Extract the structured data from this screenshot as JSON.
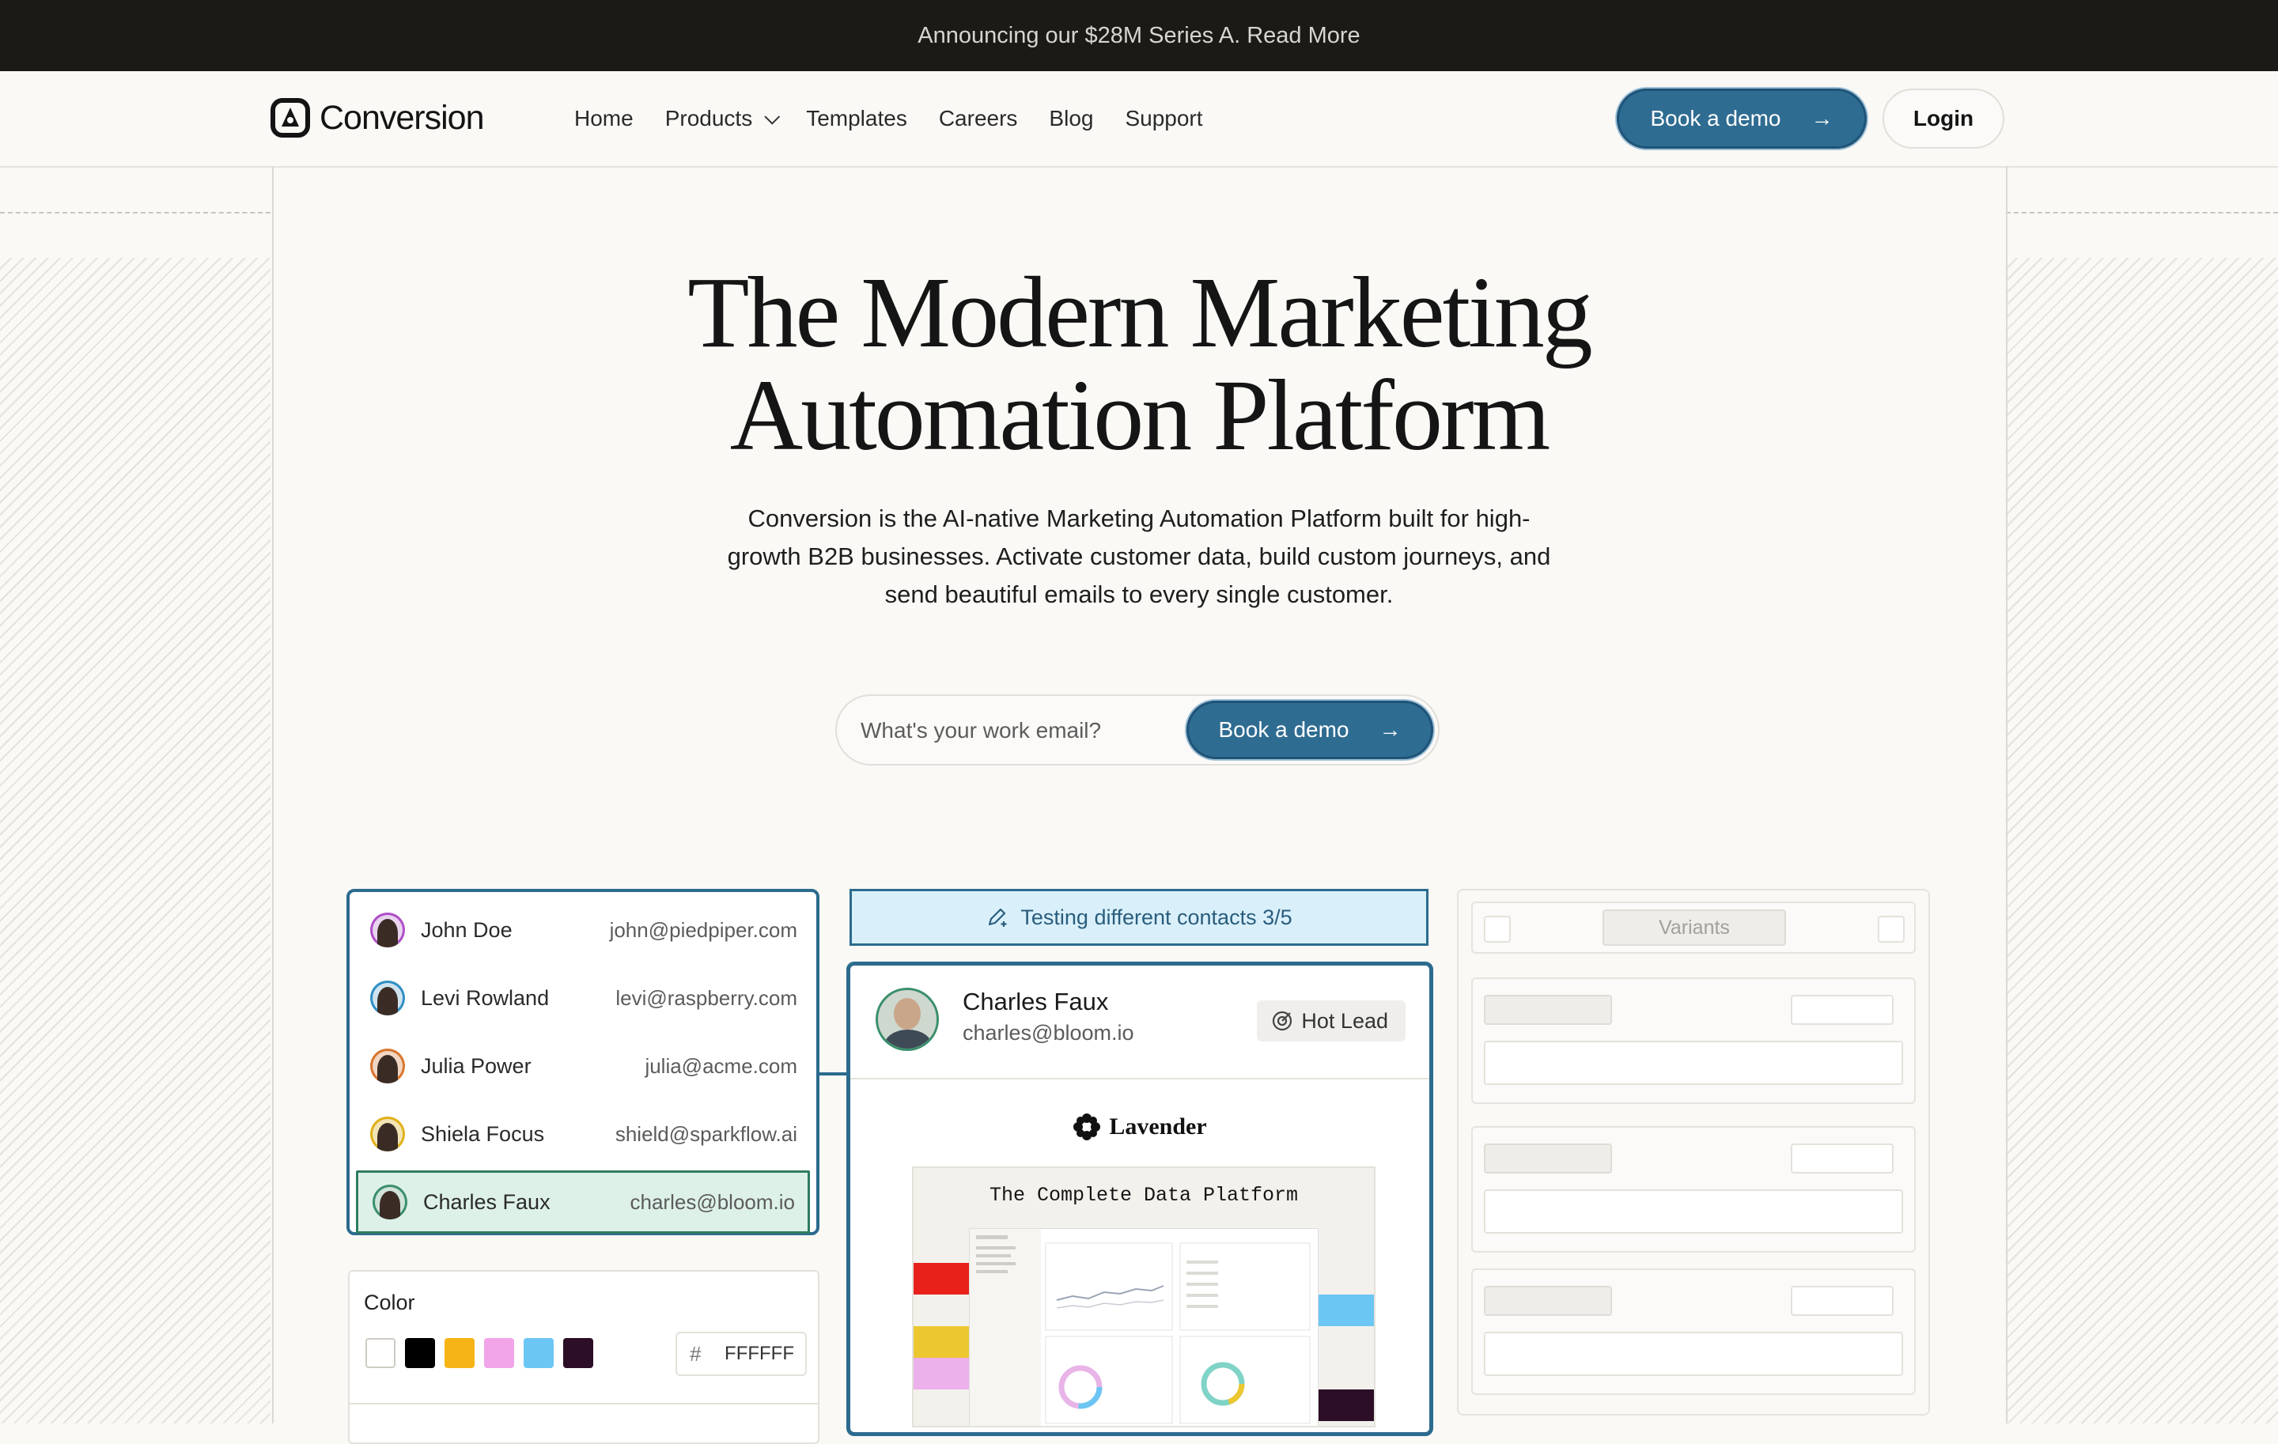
{
  "announcement": "Announcing our $28M Series A. Read More",
  "header": {
    "brand": "Conversion",
    "nav": [
      "Home",
      "Products",
      "Templates",
      "Careers",
      "Blog",
      "Support"
    ],
    "demo_label": "Book a demo",
    "login_label": "Login"
  },
  "hero": {
    "title_line1": "The Modern Marketing",
    "title_line2": "Automation Platform",
    "subtitle": "Conversion is the AI-native Marketing Automation Platform built for high-growth B2B businesses. Activate customer data, build custom journeys, and send beautiful emails to every single customer.",
    "email_placeholder": "What's your work email?",
    "cta_label": "Book a demo"
  },
  "contacts": [
    {
      "name": "John Doe",
      "email": "john@piedpiper.com",
      "ring": "#b04fc8"
    },
    {
      "name": "Levi Rowland",
      "email": "levi@raspberry.com",
      "ring": "#2f8fc4"
    },
    {
      "name": "Julia Power",
      "email": "julia@acme.com",
      "ring": "#d9762e"
    },
    {
      "name": "Shiela Focus",
      "email": "shield@sparkflow.ai",
      "ring": "#e0b11a"
    },
    {
      "name": "Charles Faux",
      "email": "charles@bloom.io",
      "ring": "#3a8f6c",
      "selected": true
    }
  ],
  "color_panel": {
    "label": "Color",
    "swatches": [
      "#ffffff",
      "#000000",
      "#f7b416",
      "#f1a5e8",
      "#6cc6f4",
      "#2c0e26"
    ],
    "hash": "#",
    "hex_value": "FFFFFF"
  },
  "testing_banner": "Testing different contacts 3/5",
  "contact_card": {
    "name": "Charles Faux",
    "email": "charles@bloom.io",
    "tag": "Hot Lead",
    "company": "Lavender",
    "preview_title": "The Complete Data Platform",
    "preview_colors": [
      "#e8221b",
      "#ecc730",
      "#ecb0ea",
      "#6cc6f4",
      "#2c0e26"
    ]
  },
  "variants": {
    "label": "Variants"
  }
}
